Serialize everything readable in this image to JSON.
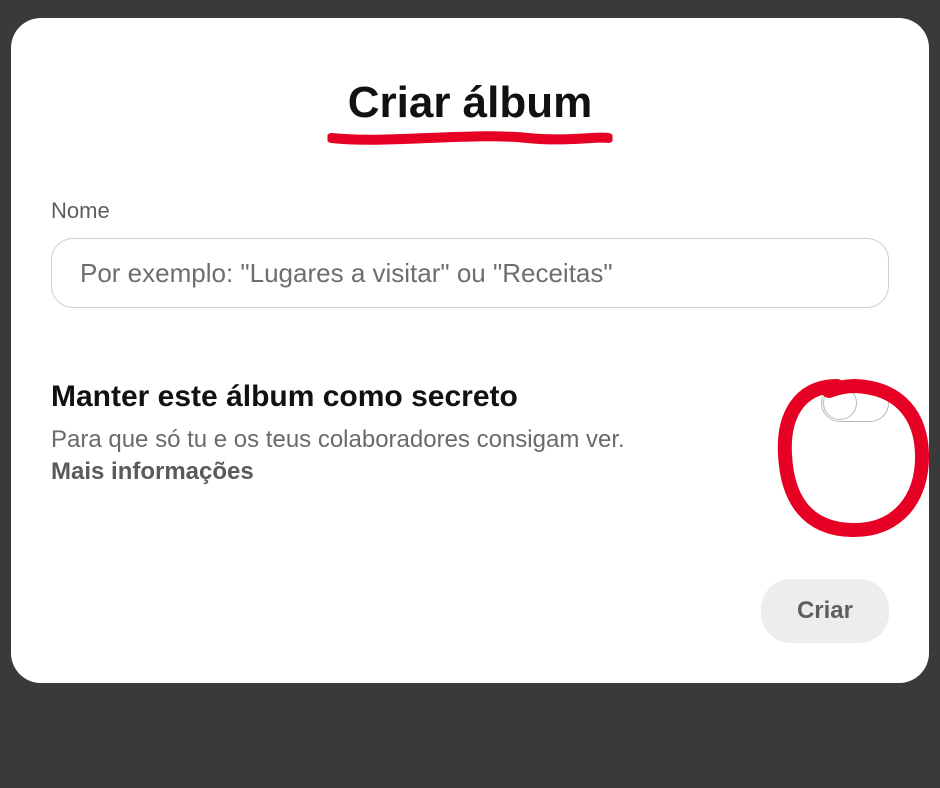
{
  "modal": {
    "title": "Criar álbum",
    "nameLabel": "Nome",
    "namePlaceholder": "Por exemplo: \"Lugares a visitar\" ou \"Receitas\"",
    "nameValue": "",
    "secret": {
      "heading": "Manter este álbum como secreto",
      "description": "Para que só tu e os teus colaboradores consigam ver.",
      "moreInfo": "Mais informações",
      "enabled": false
    },
    "createButtonLabel": "Criar"
  },
  "annotations": {
    "titleUnderlineColor": "#e60023",
    "circleColor": "#e60023"
  }
}
